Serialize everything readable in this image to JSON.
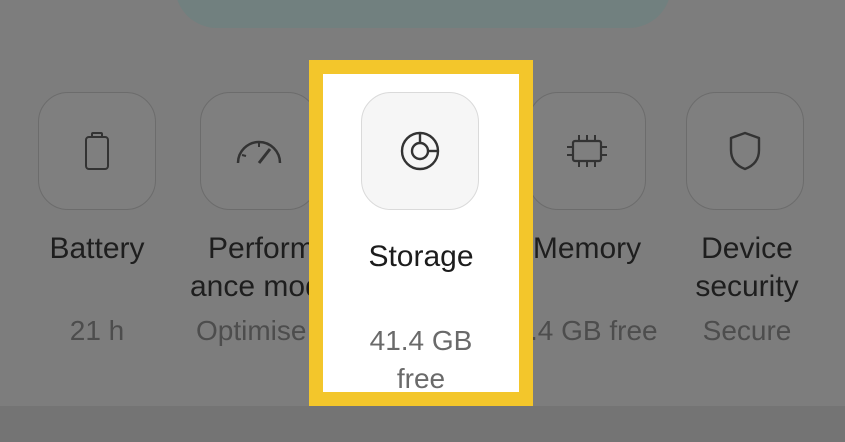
{
  "items": [
    {
      "label": "Battery",
      "value": "21 h",
      "icon": "battery-icon"
    },
    {
      "label": "Perform ance mode",
      "label_line1": "Perform",
      "label_line2": "ance mode",
      "value": "Optimise",
      "icon": "speedometer-icon"
    },
    {
      "label": "Storage",
      "value": "41.4 GB free",
      "value_line1": "41.4 GB",
      "value_line2": "free",
      "icon": "storage-icon"
    },
    {
      "label": "Memory",
      "value": ".4 GB free",
      "icon": "memory-chip-icon"
    },
    {
      "label": "Device security",
      "label_line1": "Device",
      "label_line2": "security",
      "value": "Secure",
      "icon": "shield-icon"
    }
  ],
  "highlight_color": "#f3c62b",
  "overlay_color": "#7d7d7d",
  "selected": "Storage"
}
